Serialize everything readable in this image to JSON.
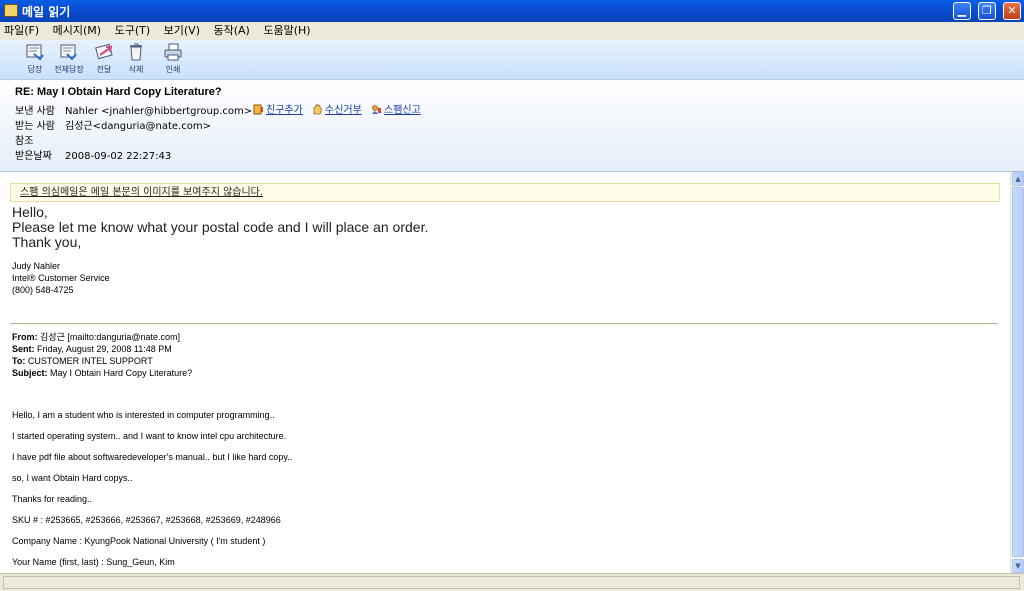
{
  "window": {
    "title": "메일 읽기",
    "buttons": {
      "minimize": "▁",
      "restore": "❐",
      "close": "✕"
    }
  },
  "menu": [
    "파일(F)",
    "메시지(M)",
    "도구(T)",
    "보기(V)",
    "동작(A)",
    "도움말(H)"
  ],
  "toolbar": [
    {
      "label": "답장",
      "icon": "reply-icon"
    },
    {
      "label": "전체답장",
      "icon": "reply-all-icon"
    },
    {
      "label": "전달",
      "icon": "forward-icon"
    },
    {
      "label": "삭제",
      "icon": "delete-icon"
    },
    {
      "label": "인쇄",
      "icon": "print-icon"
    }
  ],
  "header": {
    "subject": "RE: May I Obtain Hard Copy Literature?",
    "from_label": "보낸 사람",
    "from_value": "Nahler <jnahler@hibbertgroup.com>",
    "to_label": "받는 사람",
    "to_value": "김성근<danguria@nate.com>",
    "cc_label": "참조",
    "cc_value": "",
    "date_label": "받은날짜",
    "date_value": "2008-09-02 22:27:43",
    "actions": [
      {
        "label": "친구추가",
        "icon": "add-friend-icon"
      },
      {
        "label": "수신거부",
        "icon": "block-icon"
      },
      {
        "label": "스팸신고",
        "icon": "spam-report-icon"
      }
    ]
  },
  "body": {
    "notice": "스팸 의심메일은 메일 본문의 이미지를 보여주지 않습니다.",
    "reply_lines": [
      "Hello,",
      "Please let me know what your postal code  and I will place an order.",
      "Thank you,"
    ],
    "signature": [
      "Judy Nahler",
      "Intel® Customer Service",
      "(800) 548-4725"
    ],
    "original": {
      "from_label": "From:",
      "from_value": "김성근 [mailto:danguria@nate.com]",
      "sent_label": "Sent:",
      "sent_value": "Friday, August 29, 2008 11:48 PM",
      "to_label": "To:",
      "to_value": "CUSTOMER INTEL SUPPORT",
      "subject_label": "Subject:",
      "subject_value": "May I Obtain Hard Copy Literature?",
      "lines": [
        "Hello, I am a student who is interested in computer programming..",
        "I started operating system.. and I want to know intel cpu architecture.",
        "I have pdf file about softwaredeveloper's manual.. but I like hard copy..",
        "so, I want Obtain Hard copys..",
        "Thanks for reading..",
        "SKU # : #253665, #253666, #253667, #253668, #253669, #248966",
        "Company Name : KyungPook National University ( I'm student )",
        "Your Name (first, last) : Sung_Geun, Kim"
      ]
    }
  },
  "scrollbar": {
    "up": "▲",
    "down": "▼"
  }
}
